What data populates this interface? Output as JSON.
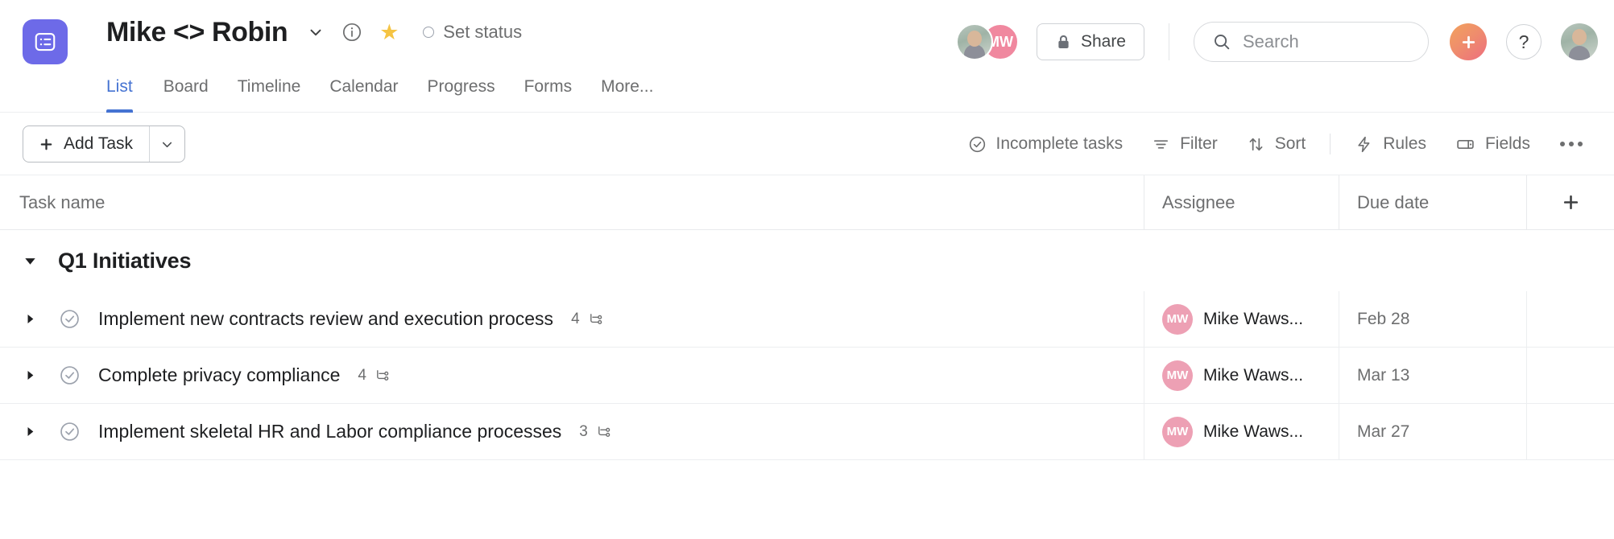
{
  "header": {
    "project_icon": "list-icon",
    "project_title": "Mike <> Robin",
    "title_chevron": "chevron-down-icon",
    "info_icon": "info-icon",
    "star_icon": "star-icon",
    "set_status_label": "Set status",
    "tabs": [
      {
        "label": "List",
        "active": true
      },
      {
        "label": "Board",
        "active": false
      },
      {
        "label": "Timeline",
        "active": false
      },
      {
        "label": "Calendar",
        "active": false
      },
      {
        "label": "Progress",
        "active": false
      },
      {
        "label": "Forms",
        "active": false
      },
      {
        "label": "More...",
        "active": false
      }
    ],
    "members": [
      {
        "initials": "",
        "type": "photo"
      },
      {
        "initials": "MW",
        "type": "initials",
        "color": "#f0889f"
      }
    ],
    "share_label": "Share",
    "share_icon": "lock-icon",
    "search_placeholder": "Search",
    "search_icon": "search-icon",
    "plus_icon": "plus-icon",
    "help_label": "?",
    "user_avatar": "user-avatar"
  },
  "toolbar": {
    "add_task_label": "Add Task",
    "add_task_plus_icon": "plus-icon",
    "add_task_caret_icon": "chevron-down-icon",
    "items": [
      {
        "label": "Incomplete tasks",
        "icon": "check-circle-icon"
      },
      {
        "label": "Filter",
        "icon": "filter-icon"
      },
      {
        "label": "Sort",
        "icon": "sort-arrows-icon"
      },
      {
        "label": "Rules",
        "icon": "lightning-bolt-icon"
      },
      {
        "label": "Fields",
        "icon": "fields-icon"
      }
    ],
    "more_icon": "ellipsis-icon"
  },
  "table": {
    "columns": {
      "task_name": "Task name",
      "assignee": "Assignee",
      "due_date": "Due date",
      "add_column_icon": "plus-icon"
    },
    "sections": [
      {
        "title": "Q1 Initiatives",
        "collapse_icon": "triangle-down-icon",
        "rows": [
          {
            "expand_icon": "triangle-right-icon",
            "complete_icon": "check-circle-icon",
            "name": "Implement new contracts review and execution process",
            "subtask_count": "4",
            "subtask_icon": "subtask-tree-icon",
            "assignee_initials": "MW",
            "assignee_name": "Mike Waws...",
            "due_date": "Feb 28"
          },
          {
            "expand_icon": "triangle-right-icon",
            "complete_icon": "check-circle-icon",
            "name": "Complete privacy compliance",
            "subtask_count": "4",
            "subtask_icon": "subtask-tree-icon",
            "assignee_initials": "MW",
            "assignee_name": "Mike Waws...",
            "due_date": "Mar 13"
          },
          {
            "expand_icon": "triangle-right-icon",
            "complete_icon": "check-circle-icon",
            "name": "Implement skeletal HR and Labor compliance processes",
            "subtask_count": "3",
            "subtask_icon": "subtask-tree-icon",
            "assignee_initials": "MW",
            "assignee_name": "Mike Waws...",
            "due_date": "Mar 27"
          }
        ]
      }
    ]
  },
  "colors": {
    "accent_blue": "#4573d2",
    "project_purple": "#6d6ae8",
    "avatar_pink": "#eda0b4",
    "star_yellow": "#f5c443",
    "text_primary": "#1e1f21",
    "text_secondary": "#6d6e6f"
  }
}
